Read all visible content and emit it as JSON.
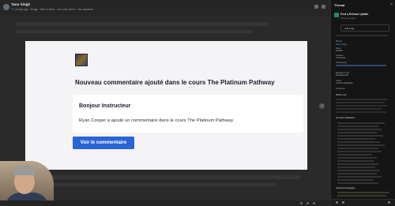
{
  "header": {
    "name": "Tanu Singh",
    "meta": "© 1.0 days ago · 2h ago · Seen 3 times · via Loom video ▾ · No answered"
  },
  "email": {
    "heading": "Nouveau commentaire ajouté dans le cours The Platinum Pathway",
    "greeting": "Bonjour Instructeur",
    "message": "Ryan Cooper a ajouté un commentaire dans le cours The Platinum Pathway",
    "button_label": "Voir le commentaire"
  },
  "panel": {
    "title": "Thread",
    "close": "×",
    "app_title": "Post a Release Update",
    "app_sub": "Pending review",
    "pill": "Add a tag",
    "owner_label": "Owner",
    "owner_value": "Tanu Singh",
    "team_label": "Team",
    "team_value": "Product",
    "feature_label": "Feature",
    "feature_value": "Comments",
    "changelog_label": "Changelog",
    "release_label": "Release Type",
    "release_value": "Enhancement",
    "label_label": "Label",
    "label_value": "Course notification",
    "overview_label": "Overview",
    "whats_new": "What's new",
    "notif_label": "All email notifications",
    "languages_label": "Supported languages"
  },
  "icons": {
    "avatar": "avatar-icon",
    "next": "chevron-right-icon",
    "close": "close-icon"
  }
}
